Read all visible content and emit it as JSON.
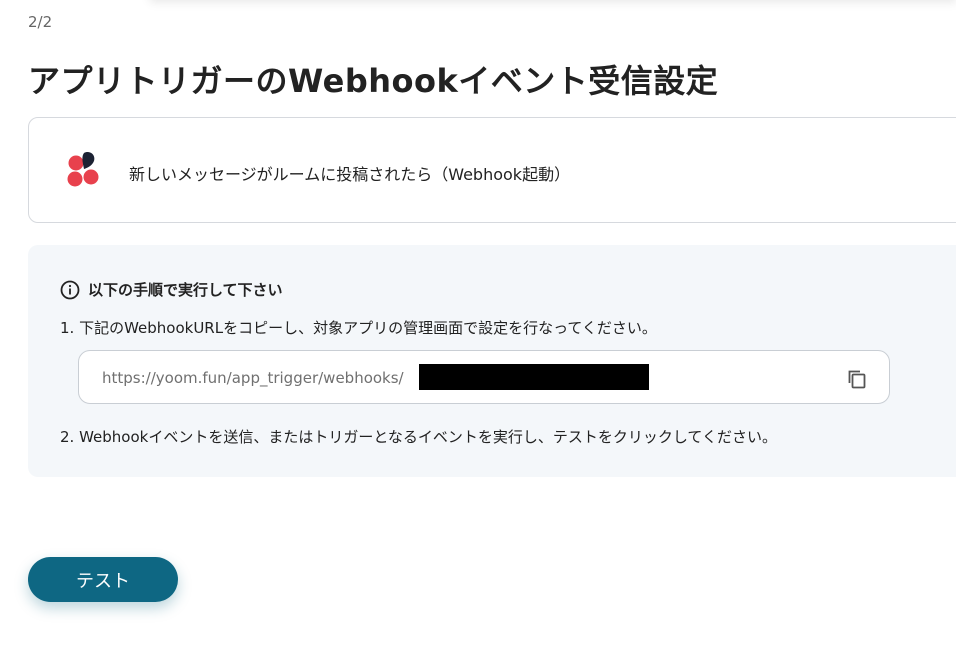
{
  "step_indicator": "2/2",
  "page_title": "アプリトリガーのWebhookイベント受信設定",
  "app_card": {
    "logo_icon": "chatwork-logo-icon",
    "trigger_label": "新しいメッセージがルームに投稿されたら（Webhook起動）"
  },
  "instructions": {
    "heading": "以下の手順で実行して下さい",
    "icon": "info-icon",
    "step1": "1. 下記のWebhookURLをコピーし、対象アプリの管理画面で設定を行なってください。",
    "url": "https://yoom.fun/app_trigger/webhooks/",
    "copy_icon": "copy-icon",
    "step2": "2. Webhookイベントを送信、またはトリガーとなるイベントを実行し、テストをクリックしてください。"
  },
  "test_button": {
    "label": "テスト"
  },
  "colors": {
    "button_bg": "#0e6783",
    "panel_bg": "#f4f7fa",
    "logo_red": "#e8414d",
    "logo_dark": "#1c2233"
  }
}
